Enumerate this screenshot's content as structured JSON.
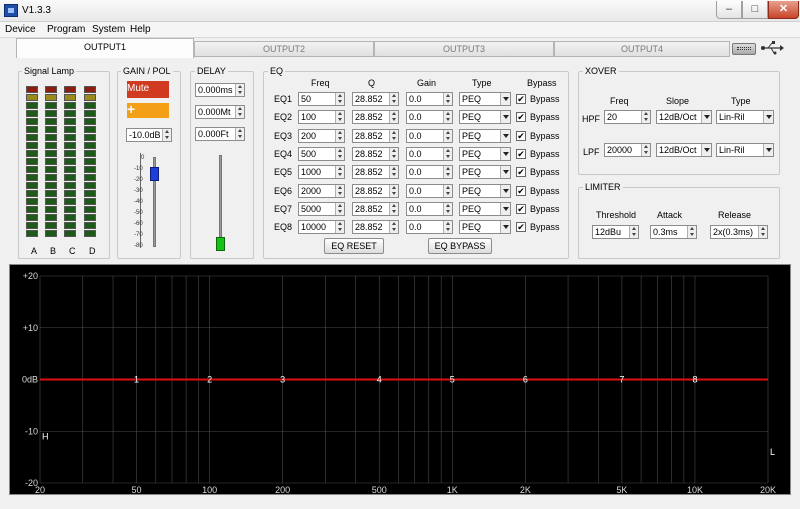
{
  "window": {
    "title": "V1.3.3"
  },
  "menu": [
    "Device",
    "Program",
    "System",
    "Help"
  ],
  "tabs": [
    "OUTPUT1",
    "OUTPUT2",
    "OUTPUT3",
    "OUTPUT4"
  ],
  "signal_lamp": {
    "title": "Signal Lamp",
    "channels": [
      "A",
      "B",
      "C",
      "D"
    ]
  },
  "gain_pol": {
    "title": "GAIN / POL",
    "mute_label": "Mute",
    "pol_label": "+",
    "gain_value": "-10.0dB",
    "scale": [
      "0",
      "-10",
      "-20",
      "-30",
      "-40",
      "-50",
      "-60",
      "-70",
      "-80"
    ],
    "level_db": -10
  },
  "delay": {
    "title": "DELAY",
    "ms": "0.000ms",
    "mt": "0.000Mt",
    "ft": "0.000Ft"
  },
  "eq": {
    "title": "EQ",
    "headers": {
      "freq": "Freq",
      "q": "Q",
      "gain": "Gain",
      "type": "Type",
      "bypass": "Bypass"
    },
    "bands": [
      {
        "name": "EQ1",
        "freq": "50",
        "q": "28.852",
        "gain": "0.0",
        "type": "PEQ",
        "bypass": "Bypass"
      },
      {
        "name": "EQ2",
        "freq": "100",
        "q": "28.852",
        "gain": "0.0",
        "type": "PEQ",
        "bypass": "Bypass"
      },
      {
        "name": "EQ3",
        "freq": "200",
        "q": "28.852",
        "gain": "0.0",
        "type": "PEQ",
        "bypass": "Bypass"
      },
      {
        "name": "EQ4",
        "freq": "500",
        "q": "28.852",
        "gain": "0.0",
        "type": "PEQ",
        "bypass": "Bypass"
      },
      {
        "name": "EQ5",
        "freq": "1000",
        "q": "28.852",
        "gain": "0.0",
        "type": "PEQ",
        "bypass": "Bypass"
      },
      {
        "name": "EQ6",
        "freq": "2000",
        "q": "28.852",
        "gain": "0.0",
        "type": "PEQ",
        "bypass": "Bypass"
      },
      {
        "name": "EQ7",
        "freq": "5000",
        "q": "28.852",
        "gain": "0.0",
        "type": "PEQ",
        "bypass": "Bypass"
      },
      {
        "name": "EQ8",
        "freq": "10000",
        "q": "28.852",
        "gain": "0.0",
        "type": "PEQ",
        "bypass": "Bypass"
      }
    ],
    "reset_label": "EQ RESET",
    "bypass_label": "EQ BYPASS"
  },
  "xover": {
    "title": "XOVER",
    "headers": {
      "freq": "Freq",
      "slope": "Slope",
      "type": "Type"
    },
    "hpf": {
      "label": "HPF",
      "freq": "20",
      "slope": "12dB/Oct",
      "type": "Lin-Ril"
    },
    "lpf": {
      "label": "LPF",
      "freq": "20000",
      "slope": "12dB/Oct",
      "type": "Lin-Ril"
    }
  },
  "limiter": {
    "title": "LIMITER",
    "headers": {
      "threshold": "Threshold",
      "attack": "Attack",
      "release": "Release"
    },
    "threshold": "12dBu",
    "attack": "0.3ms",
    "release": "2x(0.3ms)"
  },
  "chart_data": {
    "type": "line",
    "xscale": "log",
    "xlim": [
      20,
      20000
    ],
    "ylim": [
      -20,
      20
    ],
    "x_ticks": [
      20,
      50,
      100,
      200,
      500,
      1000,
      2000,
      5000,
      10000,
      20000
    ],
    "x_tick_labels": [
      "20",
      "50",
      "100",
      "200",
      "500",
      "1K",
      "2K",
      "5K",
      "10K",
      "20K"
    ],
    "y_tick_labels": [
      "+20",
      "+10",
      "0dB",
      "-10",
      "-20"
    ],
    "y_ticks": [
      20,
      10,
      0,
      -10,
      -20
    ],
    "response": {
      "x": [
        20,
        20000
      ],
      "y": [
        0,
        0
      ]
    },
    "band_markers": [
      {
        "label": "1",
        "freq": 50,
        "gain": 0
      },
      {
        "label": "2",
        "freq": 100,
        "gain": 0
      },
      {
        "label": "3",
        "freq": 200,
        "gain": 0
      },
      {
        "label": "4",
        "freq": 500,
        "gain": 0
      },
      {
        "label": "5",
        "freq": 1000,
        "gain": 0
      },
      {
        "label": "6",
        "freq": 2000,
        "gain": 0
      },
      {
        "label": "7",
        "freq": 5000,
        "gain": 0
      },
      {
        "label": "8",
        "freq": 10000,
        "gain": 0
      }
    ],
    "hpf_marker": {
      "label": "H",
      "freq": 20,
      "gain": -11
    },
    "lpf_marker": {
      "label": "L",
      "freq": 20000,
      "gain": -14
    },
    "grid": true,
    "colors": {
      "background": "#000000",
      "grid": "#4a4a4a",
      "curve": "#e01010",
      "text": "#ffffff"
    }
  }
}
